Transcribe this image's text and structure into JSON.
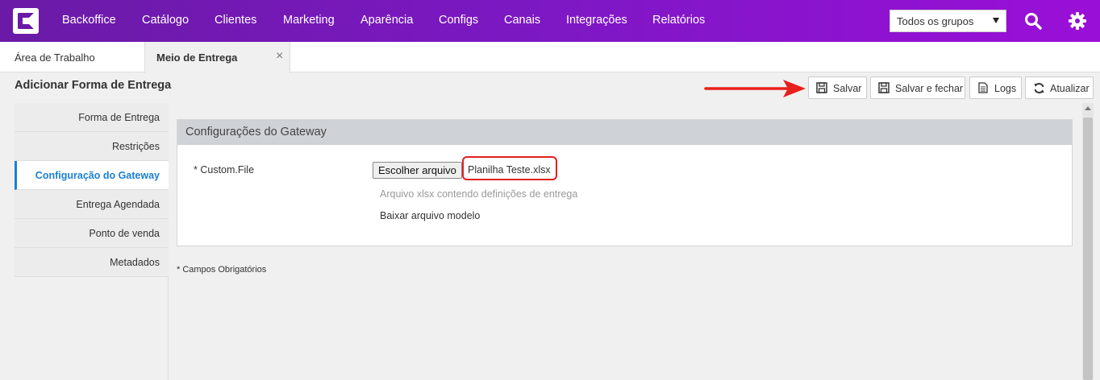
{
  "topnav": {
    "items": [
      "Backoffice",
      "Catálogo",
      "Clientes",
      "Marketing",
      "Aparência",
      "Configs",
      "Canais",
      "Integrações",
      "Relatórios"
    ],
    "group_select": "Todos os grupos"
  },
  "tabs": {
    "home": "Área de Trabalho",
    "active": "Meio de Entrega",
    "close": "×"
  },
  "page": {
    "title": "Adicionar Forma de Entrega"
  },
  "toolbar": {
    "save": "Salvar",
    "save_close": "Salvar e fechar",
    "logs": "Logs",
    "refresh": "Atualizar"
  },
  "sidebar": {
    "items": [
      "Forma de Entrega",
      "Restrições",
      "Configuração do Gateway",
      "Entrega Agendada",
      "Ponto de venda",
      "Metadados"
    ],
    "active_index": 2
  },
  "panel": {
    "title": "Configurações do Gateway",
    "field_label": "* Custom.File",
    "file_button": "Escolher arquivo",
    "file_name": "Planilha Teste.xlsx",
    "hint": "Arquivo xlsx contendo definições de entrega",
    "download_link": "Baixar arquivo modelo"
  },
  "footer": {
    "required_note": "* Campos Obrigatórios"
  },
  "colors": {
    "nav_gradient_start": "#6a1aa6",
    "nav_gradient_end": "#9a0fd8",
    "active_accent": "#1a7fd1",
    "highlight_red": "#e02020"
  },
  "icons": [
    "logo-icon",
    "search-icon",
    "gear-icon",
    "save-icon",
    "logs-icon",
    "refresh-icon",
    "close-icon",
    "arrow-annotation"
  ]
}
